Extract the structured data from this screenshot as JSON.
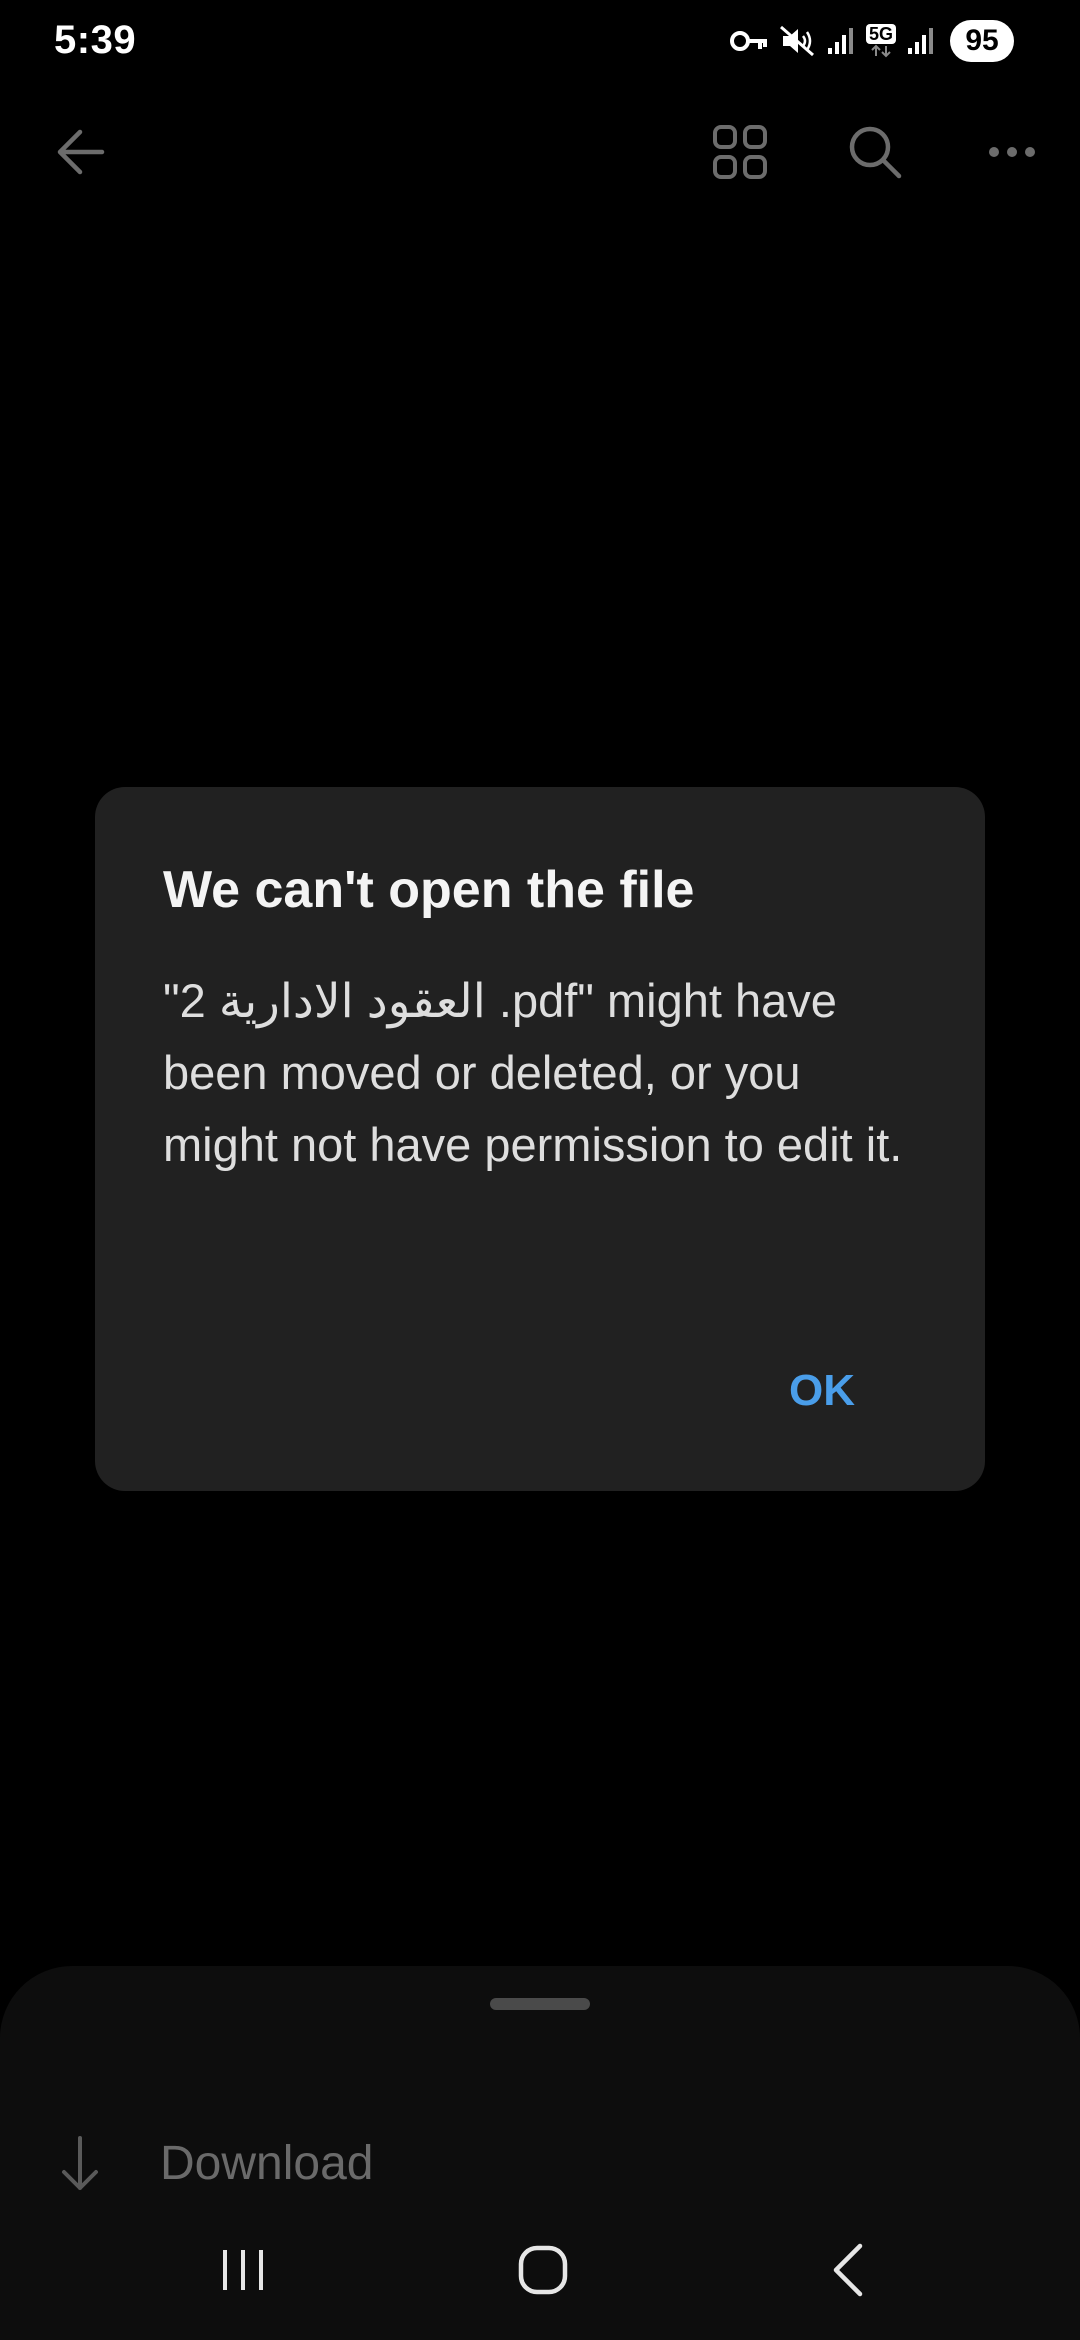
{
  "status_bar": {
    "time": "5:39",
    "network_label": "5G",
    "battery_level": "95",
    "icons": [
      "vpn-key-icon",
      "mute-icon",
      "signal-icon",
      "5g-icon",
      "signal-icon",
      "battery-icon"
    ]
  },
  "toolbar": {
    "icons": [
      "back-arrow-icon",
      "grid-view-icon",
      "search-icon",
      "more-options-icon"
    ]
  },
  "dialog": {
    "title": "We can't open the file",
    "message": "\"2 العقود الادارية .pdf\" might have been moved or deleted, or you might not have permission to edit it.",
    "ok_label": "OK"
  },
  "bottom_sheet": {
    "items": [
      {
        "label": "Download",
        "icon": "download-arrow-icon"
      }
    ]
  },
  "navigation_bar": {
    "icons": [
      "recent-apps-icon",
      "home-icon",
      "back-icon"
    ]
  },
  "colors": {
    "background": "#000000",
    "dialog_background": "#212121",
    "accent": "#4a9eea",
    "sheet_background": "#0d0d0d"
  }
}
